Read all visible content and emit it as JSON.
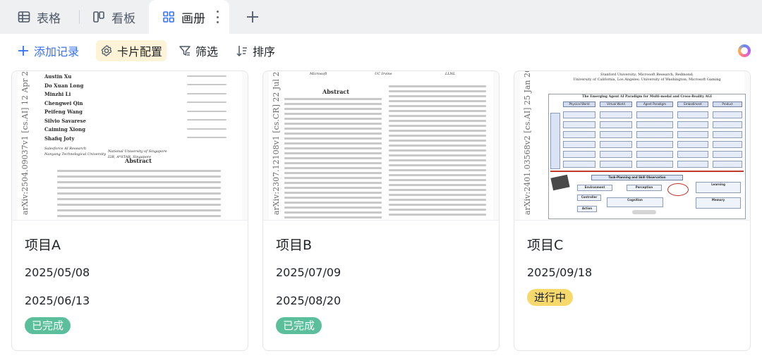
{
  "tabs": [
    {
      "label": "表格",
      "icon": "table-icon",
      "active": false
    },
    {
      "label": "看板",
      "icon": "kanban-icon",
      "active": false
    },
    {
      "label": "画册",
      "icon": "gallery-icon",
      "active": true
    }
  ],
  "toolbar": {
    "add_label": "添加记录",
    "card_label": "卡片配置",
    "filter_label": "筛选",
    "sort_label": "排序"
  },
  "colors": {
    "accent": "#3370ff",
    "done_badge": "#5bbf9c",
    "doing_badge": "#f7d86a",
    "card_config_bg": "#fdf3d6"
  },
  "cards": [
    {
      "title": "项目A",
      "date_start": "2025/05/08",
      "date_end": "2025/06/13",
      "status": "已完成",
      "cover": {
        "arxiv_id": "arXiv:2504.09037v1 [cs.AI] 12 Apr 2025",
        "authors": [
          "Austin Xu",
          "Do Xuan Long",
          "Minzhi Li",
          "Chengwei Qin",
          "Peifeng Wang",
          "Silvio Savarese",
          "Caiming Xiong",
          "Shafiq Joty"
        ],
        "affil1": "Salesforce AI Research",
        "affil2": "Nanyang Technological University",
        "affil3": "National University of Singapore",
        "affil4": "I2R, A*STAR, Singapore",
        "abstract_heading": "Abstract"
      }
    },
    {
      "title": "项目B",
      "date_start": "2025/07/09",
      "date_end": "2025/08/20",
      "status": "已完成",
      "cover": {
        "arxiv_id": "arXiv:2307.12108v1 [cs.CR] 22 Jul 2023",
        "affil1": "Microsoft",
        "affil2": "UC Irvine",
        "affil3": "LLNL",
        "abstract_heading": "Abstract"
      }
    },
    {
      "title": "项目C",
      "date_start": "2025/09/18",
      "status": "进行中",
      "cover": {
        "arxiv_id": "arXiv:2401.03568v2 [cs.AI] 25 Jan 2024",
        "affil1": "Stanford University; Microsoft Research, Redmond;",
        "affil2": "University of California, Los Angeles; University of Washington; Microsoft Gaming",
        "diagram_title": "The Emerging Agent AI Paradigm for Multi-modal and Cross-Reality AGI",
        "diagram_heads": [
          "Physical World",
          "Virtual World",
          "Agent Paradigm",
          "Embodiment",
          "Product"
        ],
        "lower_title": "Task-Planning and Skill Observation",
        "lower_boxes": [
          "Environment",
          "Perception",
          "Controller",
          "Cognition",
          "Action",
          "Learning",
          "Memory"
        ]
      }
    }
  ]
}
